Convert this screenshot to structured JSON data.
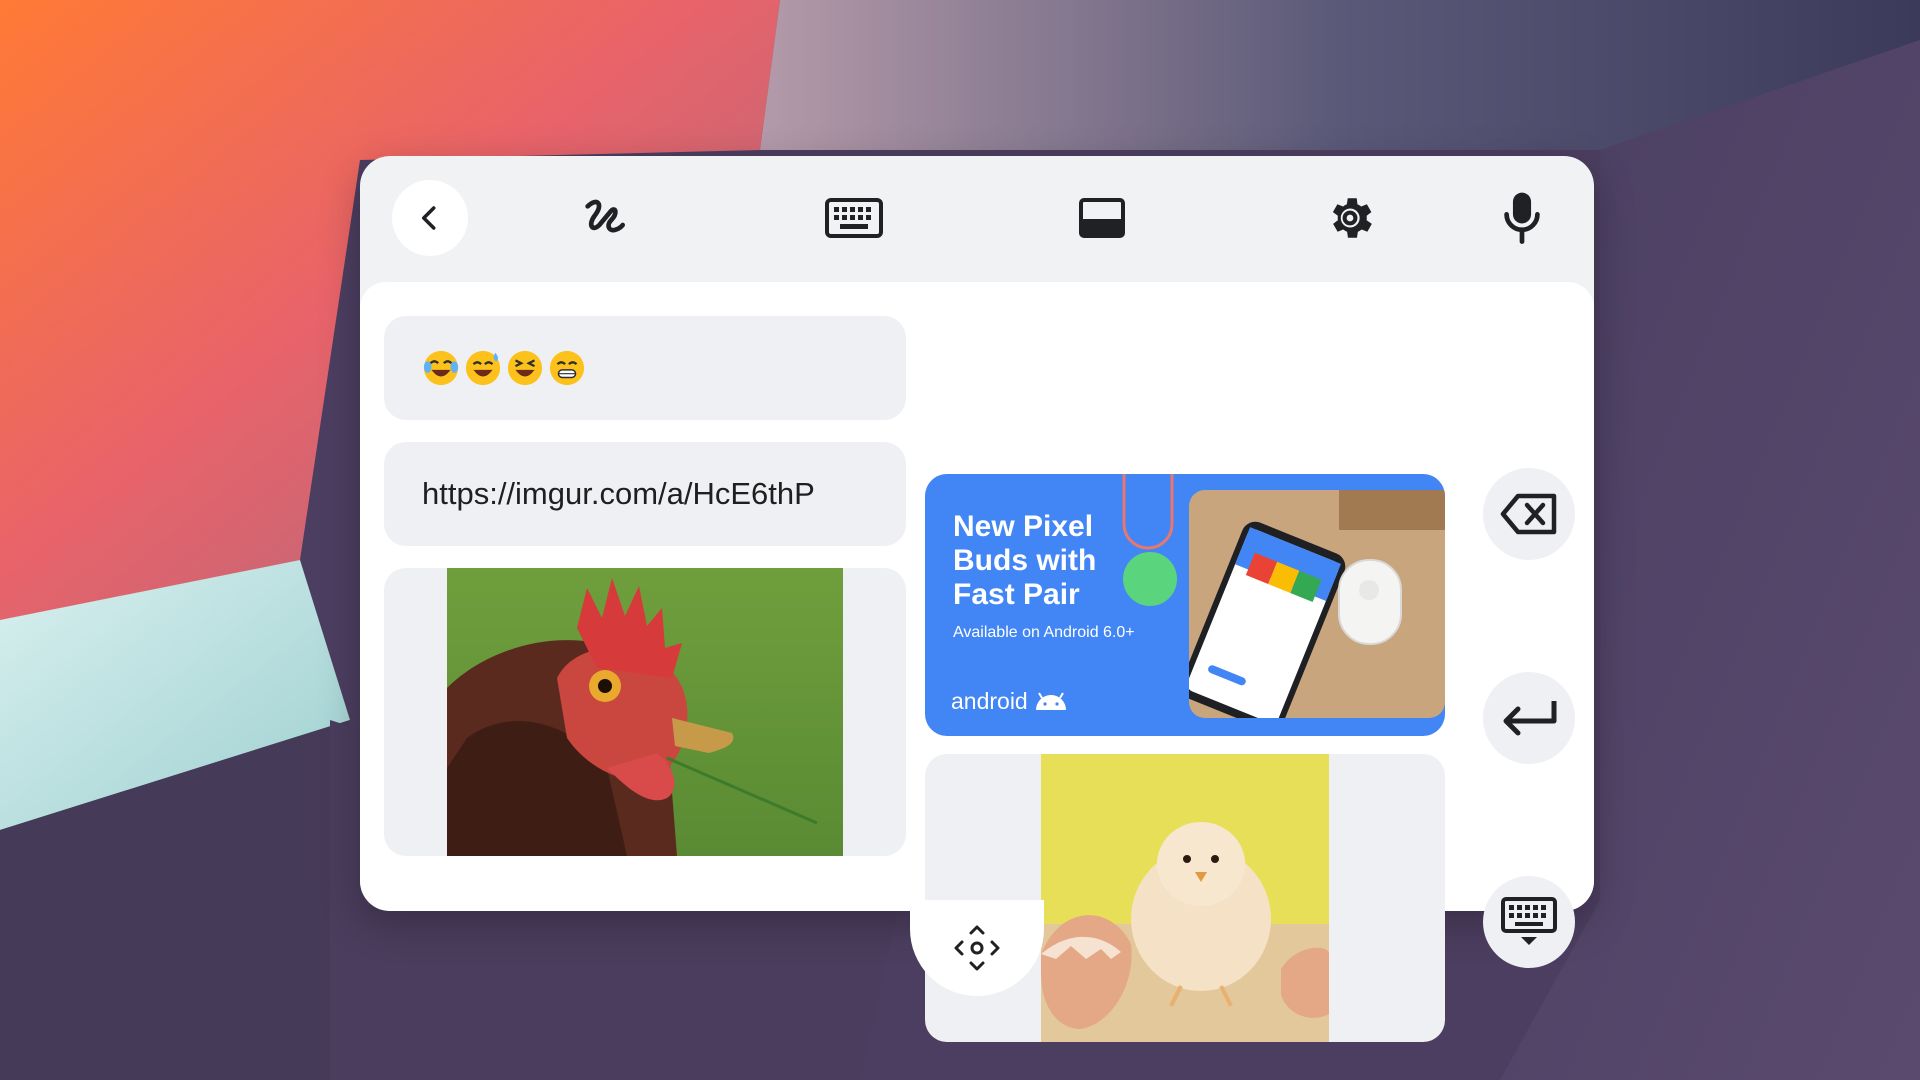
{
  "colors": {
    "panel_bg": "#f1f2f4",
    "content_bg": "#ffffff",
    "clip_bg": "#eef0f3",
    "promo_blue": "#4285f4",
    "icon": "#202124"
  },
  "toolbar": {
    "icons": [
      "back-icon",
      "handwriting-icon",
      "keyboard-icon",
      "one-handed-mode-icon",
      "settings-icon",
      "microphone-icon"
    ]
  },
  "clipboard": {
    "emoji_clip": {
      "emojis": [
        "face-with-tears-of-joy",
        "grinning-face-with-sweat",
        "grinning-squinting-face",
        "beaming-face-with-smiling-eyes"
      ]
    },
    "url_clip": {
      "text": "https://imgur.com/a/HcE6thP"
    },
    "promo_clip": {
      "headline": "New Pixel Buds with Fast Pair",
      "subtitle": "Available on Android 6.0+",
      "brand": "android"
    },
    "image_clips": [
      "rooster-photo",
      "chick-photo"
    ]
  },
  "side_actions": [
    "backspace-icon",
    "enter-icon",
    "hide-keyboard-icon"
  ],
  "handle": {
    "icon": "move-icon"
  }
}
